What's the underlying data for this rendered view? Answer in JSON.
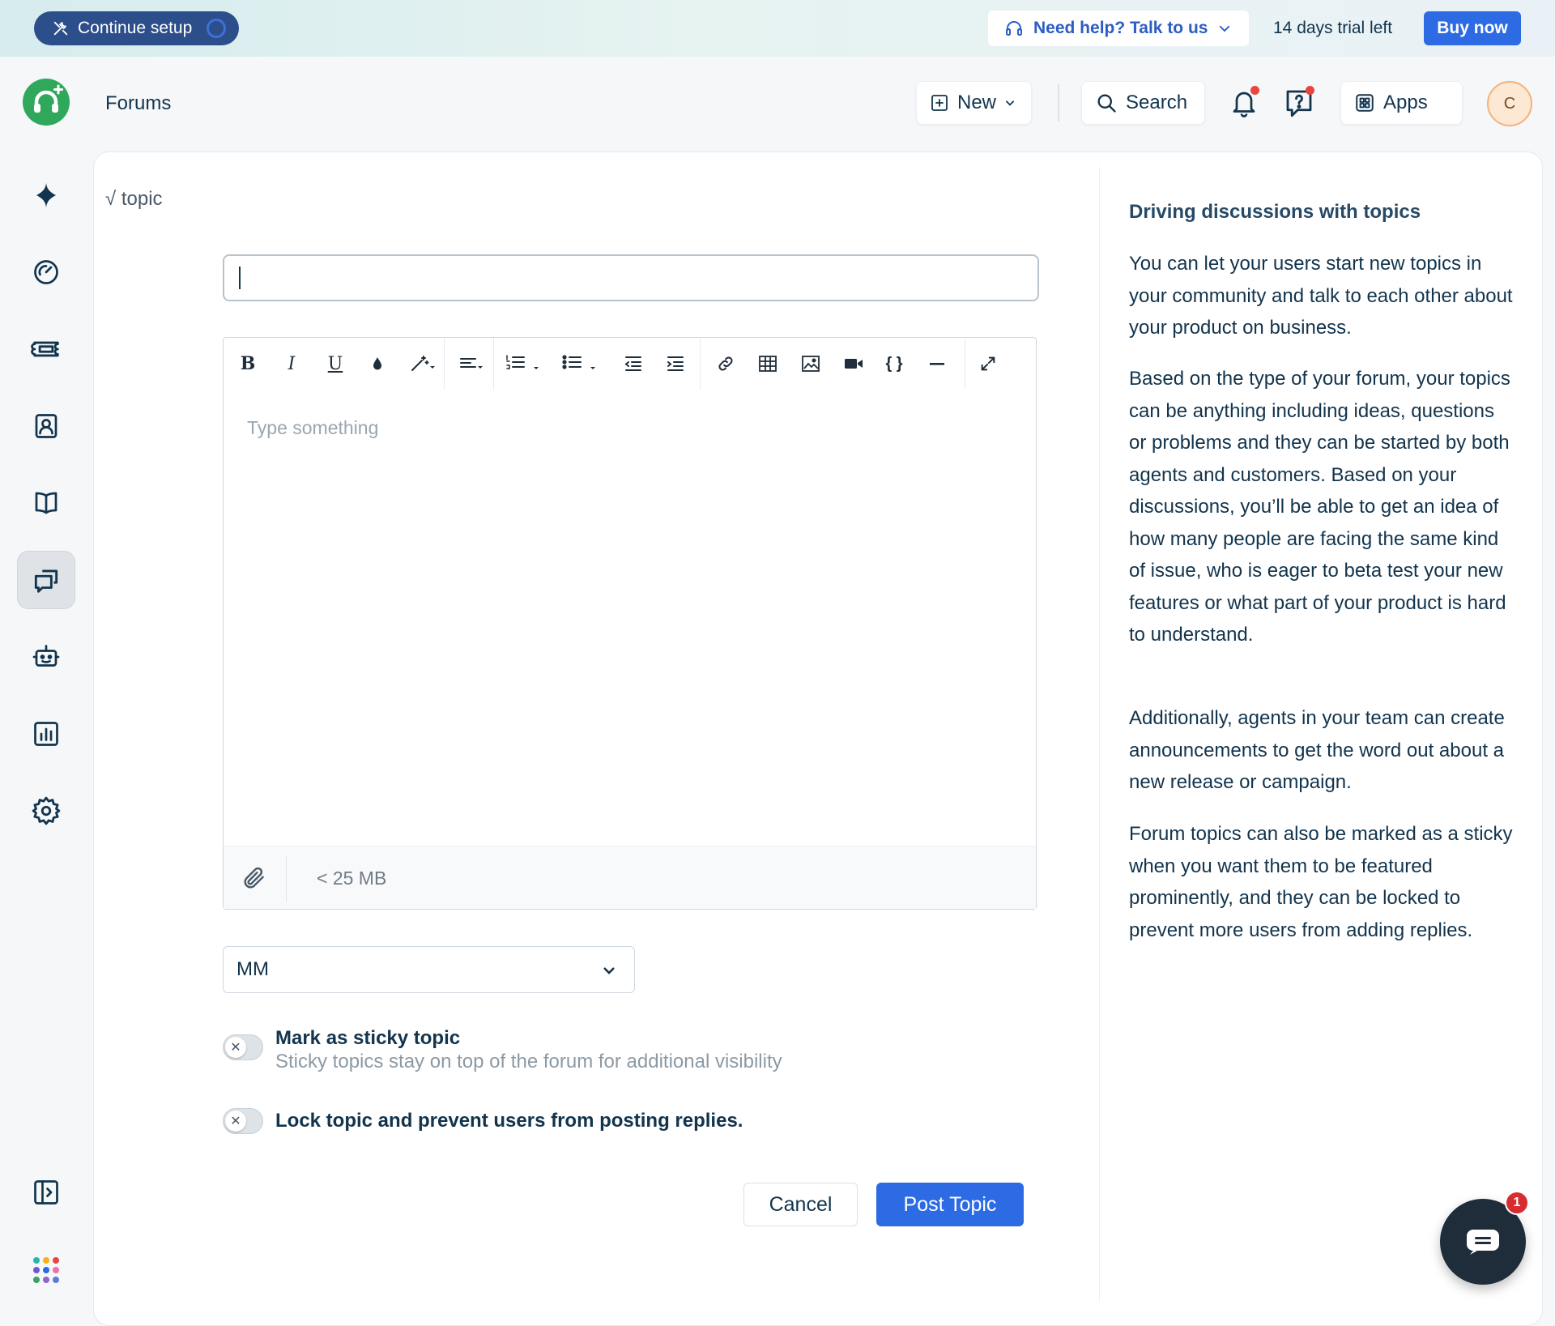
{
  "banner": {
    "continue_setup": "Continue setup",
    "help": "Need help? Talk to us",
    "trial": "14 days trial left",
    "buy": "Buy now"
  },
  "header": {
    "page_title": "Forums",
    "new_label": "New",
    "search_label": "Search",
    "apps_label": "Apps",
    "avatar_initial": "C"
  },
  "breadcrumb": "√ topic",
  "form": {
    "title_value": "",
    "editor_placeholder": "Type something",
    "attachment_limit": "< 25 MB",
    "forum_select": "MM",
    "sticky_title": "Mark as sticky topic",
    "sticky_sub": "Sticky topics stay on top of the forum for additional visibility",
    "lock_title": "Lock topic and prevent users from posting replies.",
    "cancel": "Cancel",
    "post": "Post Topic"
  },
  "toolbar_tools": [
    "bold",
    "italic",
    "underline",
    "font-color",
    "magic-format",
    "align",
    "numbered-list",
    "bulleted-list",
    "outdent",
    "indent",
    "link",
    "table",
    "image",
    "video",
    "code",
    "horizontal-rule",
    "fullscreen"
  ],
  "help_panel": {
    "title": "Driving discussions with topics",
    "p1": "You can let your users start new topics in your community and talk to each other about your product on business.",
    "p2": "Based on the type of your forum, your topics can be anything including ideas, questions or problems and they can be started by both agents and customers. Based on your discussions, you’ll be able to get an idea of how many people are facing the same kind of issue, who is eager to beta test your new features or what part of your product is hard to understand.",
    "p3": "Additionally, agents in your team can create announcements to get the word out about a new release or campaign.",
    "p4": "Forum topics can also be marked as a sticky when you want them to be featured prominently, and they can be locked to prevent more users from adding replies."
  },
  "chat": {
    "badge": "1"
  },
  "colors": {
    "primary": "#2c6be4",
    "setup_pill": "#2c4e8a",
    "logo_green": "#2fa85c",
    "notification_red": "#e8453c",
    "text_dark": "#12344d"
  }
}
